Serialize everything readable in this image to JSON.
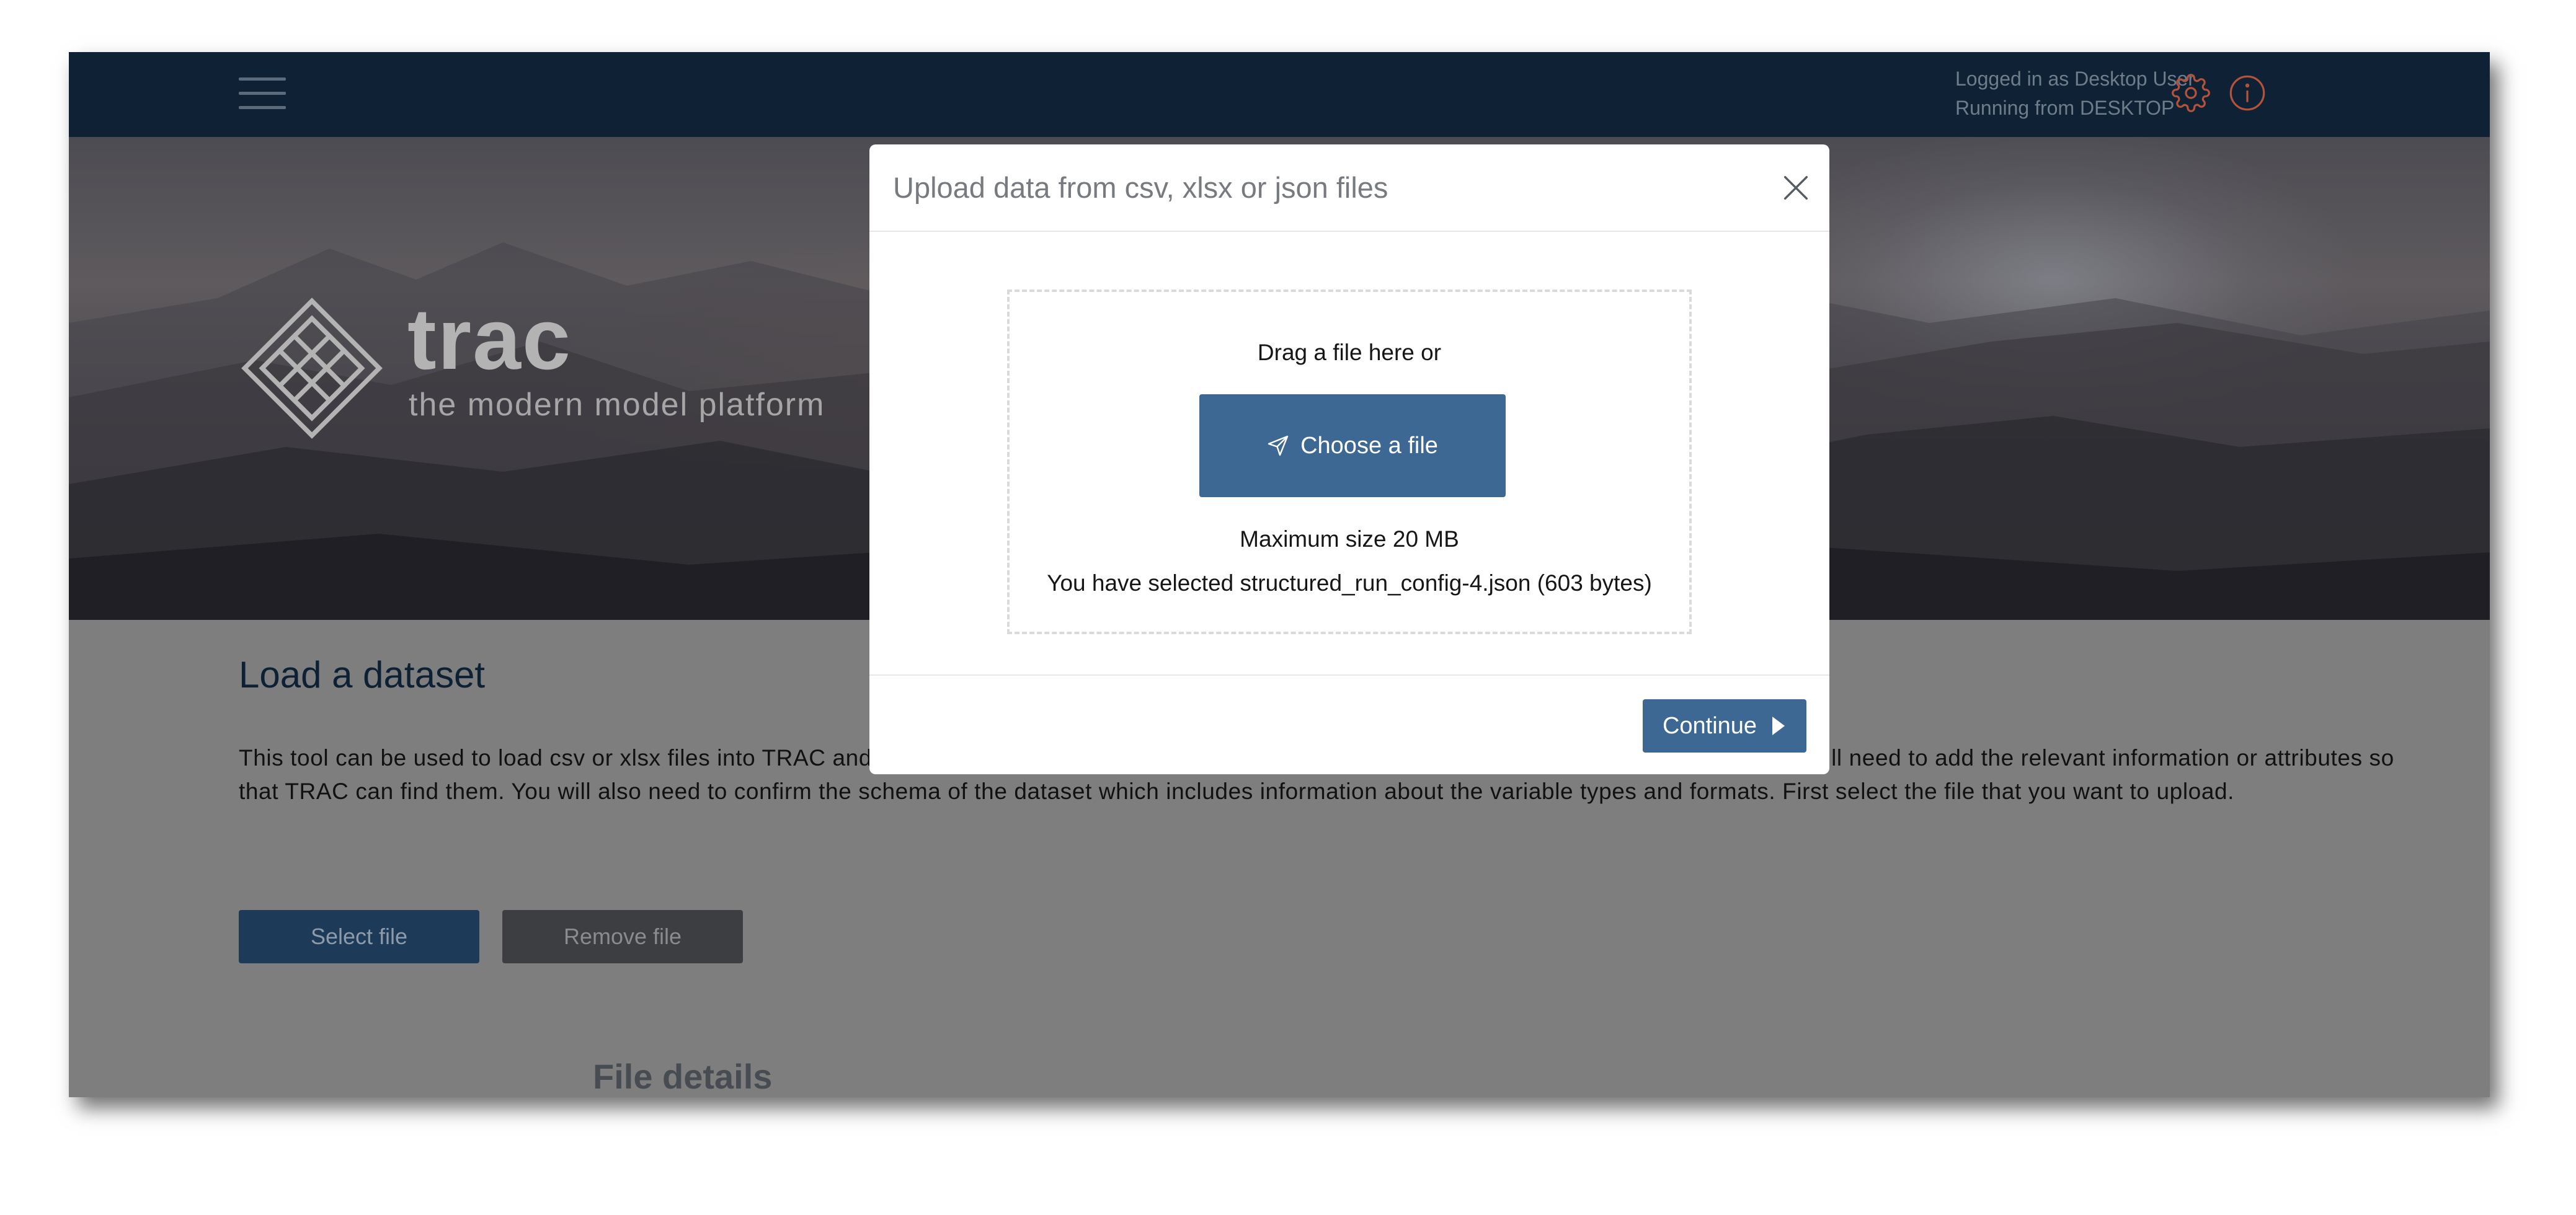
{
  "header": {
    "menu_icon": "hamburger-menu-icon",
    "user_line1": "Logged in as Desktop User",
    "user_line2": "Running from DESKTOP",
    "settings_icon": "gear-icon",
    "info_icon": "info-icon",
    "icon_color": "#b5523a"
  },
  "hero": {
    "brand_name": "trac",
    "brand_tagline": "the modern model platform",
    "logo_icon": "trac-logo-icon"
  },
  "main": {
    "title": "Load a dataset",
    "description": "This tool can be used to load csv or xlsx files into TRAC and save them as a dataset. These datasets will be available to use as model inputs but you will need to add the relevant information or attributes so that TRAC can find them. You will also need to confirm the schema of the dataset which includes information about the variable types and formats. First select the file that you want to upload.",
    "select_file_label": "Select file",
    "remove_file_label": "Remove file",
    "file_details_title": "File details"
  },
  "modal": {
    "title": "Upload data from csv, xlsx or json files",
    "close_icon": "close-icon",
    "drag_text": "Drag a file here or",
    "choose_label": "Choose a file",
    "choose_icon": "send-icon",
    "max_size_text": "Maximum size 20 MB",
    "selected_text": "You have selected structured_run_config-4.json (603 bytes)",
    "continue_label": "Continue",
    "continue_icon": "caret-right-icon",
    "accent_color": "#3d6893"
  }
}
